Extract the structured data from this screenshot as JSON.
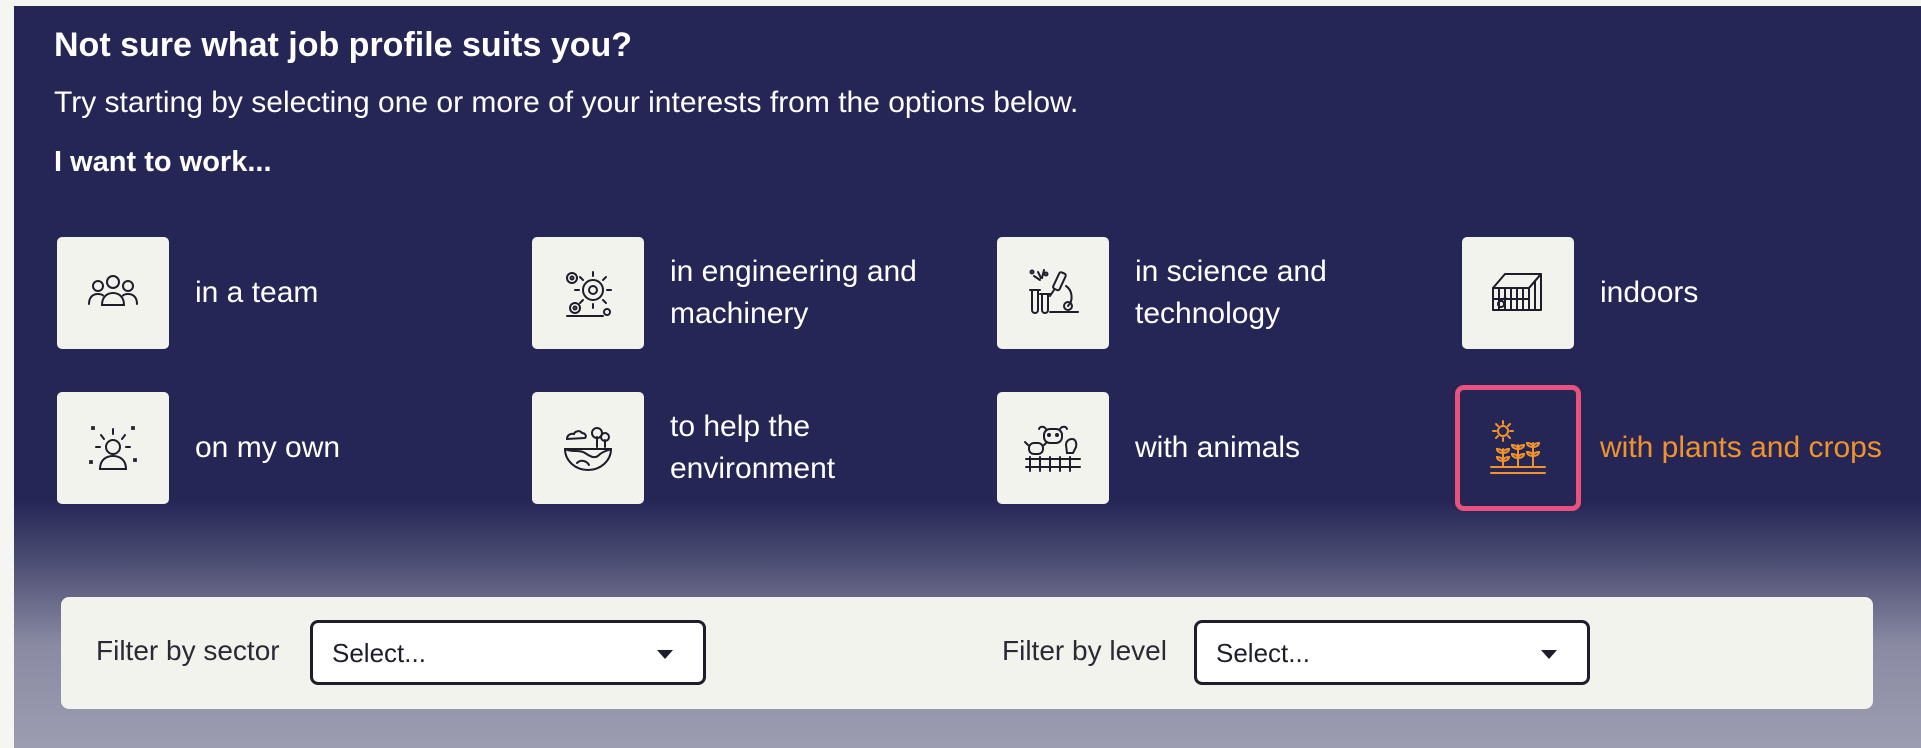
{
  "header": {
    "title": "Not sure what job profile suits you?",
    "intro": "Try starting by selecting one or more of your interests from the options below.",
    "prompt": "I want to work..."
  },
  "interests": [
    {
      "label": "in a team",
      "icon": "team-icon",
      "selected": false
    },
    {
      "label": "in engineering and machinery",
      "icon": "gears-icon",
      "selected": false
    },
    {
      "label": "in science and technology",
      "icon": "microscope-icon",
      "selected": false
    },
    {
      "label": "indoors",
      "icon": "greenhouse-icon",
      "selected": false
    },
    {
      "label": "on my own",
      "icon": "person-icon",
      "selected": false
    },
    {
      "label": "to help the environment",
      "icon": "earth-icon",
      "selected": false
    },
    {
      "label": "with animals",
      "icon": "animals-icon",
      "selected": false
    },
    {
      "label": "with plants and crops",
      "icon": "crops-icon",
      "selected": true
    }
  ],
  "filters": {
    "sector": {
      "label": "Filter by sector",
      "value": "Select..."
    },
    "level": {
      "label": "Filter by level",
      "value": "Select..."
    }
  },
  "colors": {
    "panel": "#252656",
    "tile": "#f3f3ee",
    "selected_border": "#e8527e",
    "selected_text": "#f0932b"
  }
}
